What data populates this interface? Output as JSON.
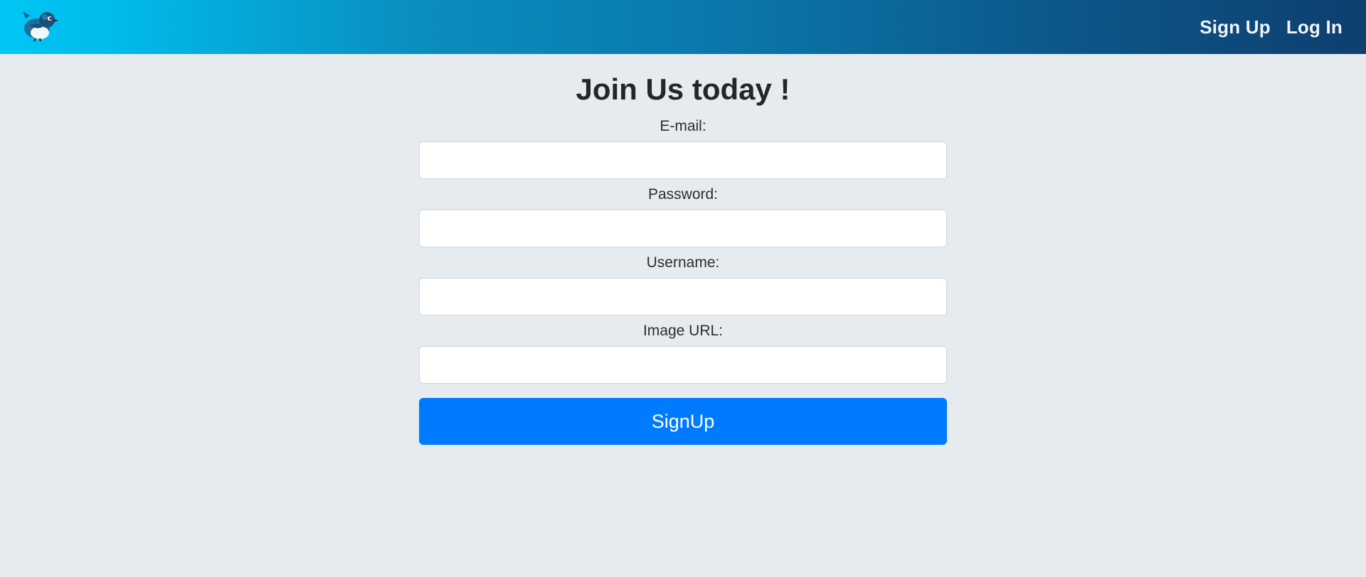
{
  "navbar": {
    "logo_icon": "bird-logo-icon",
    "links": [
      {
        "label": "Sign Up"
      },
      {
        "label": "Log In"
      }
    ],
    "gradient_colors": [
      "#00c6f5",
      "#0e3f6f"
    ]
  },
  "form": {
    "title": "Join Us today !",
    "fields": [
      {
        "label": "E-mail:",
        "value": "",
        "placeholder": ""
      },
      {
        "label": "Password:",
        "value": "",
        "placeholder": ""
      },
      {
        "label": "Username:",
        "value": "",
        "placeholder": ""
      },
      {
        "label": "Image URL:",
        "value": "",
        "placeholder": ""
      }
    ],
    "submit_label": "SignUp",
    "accent_color": "#007bff"
  }
}
